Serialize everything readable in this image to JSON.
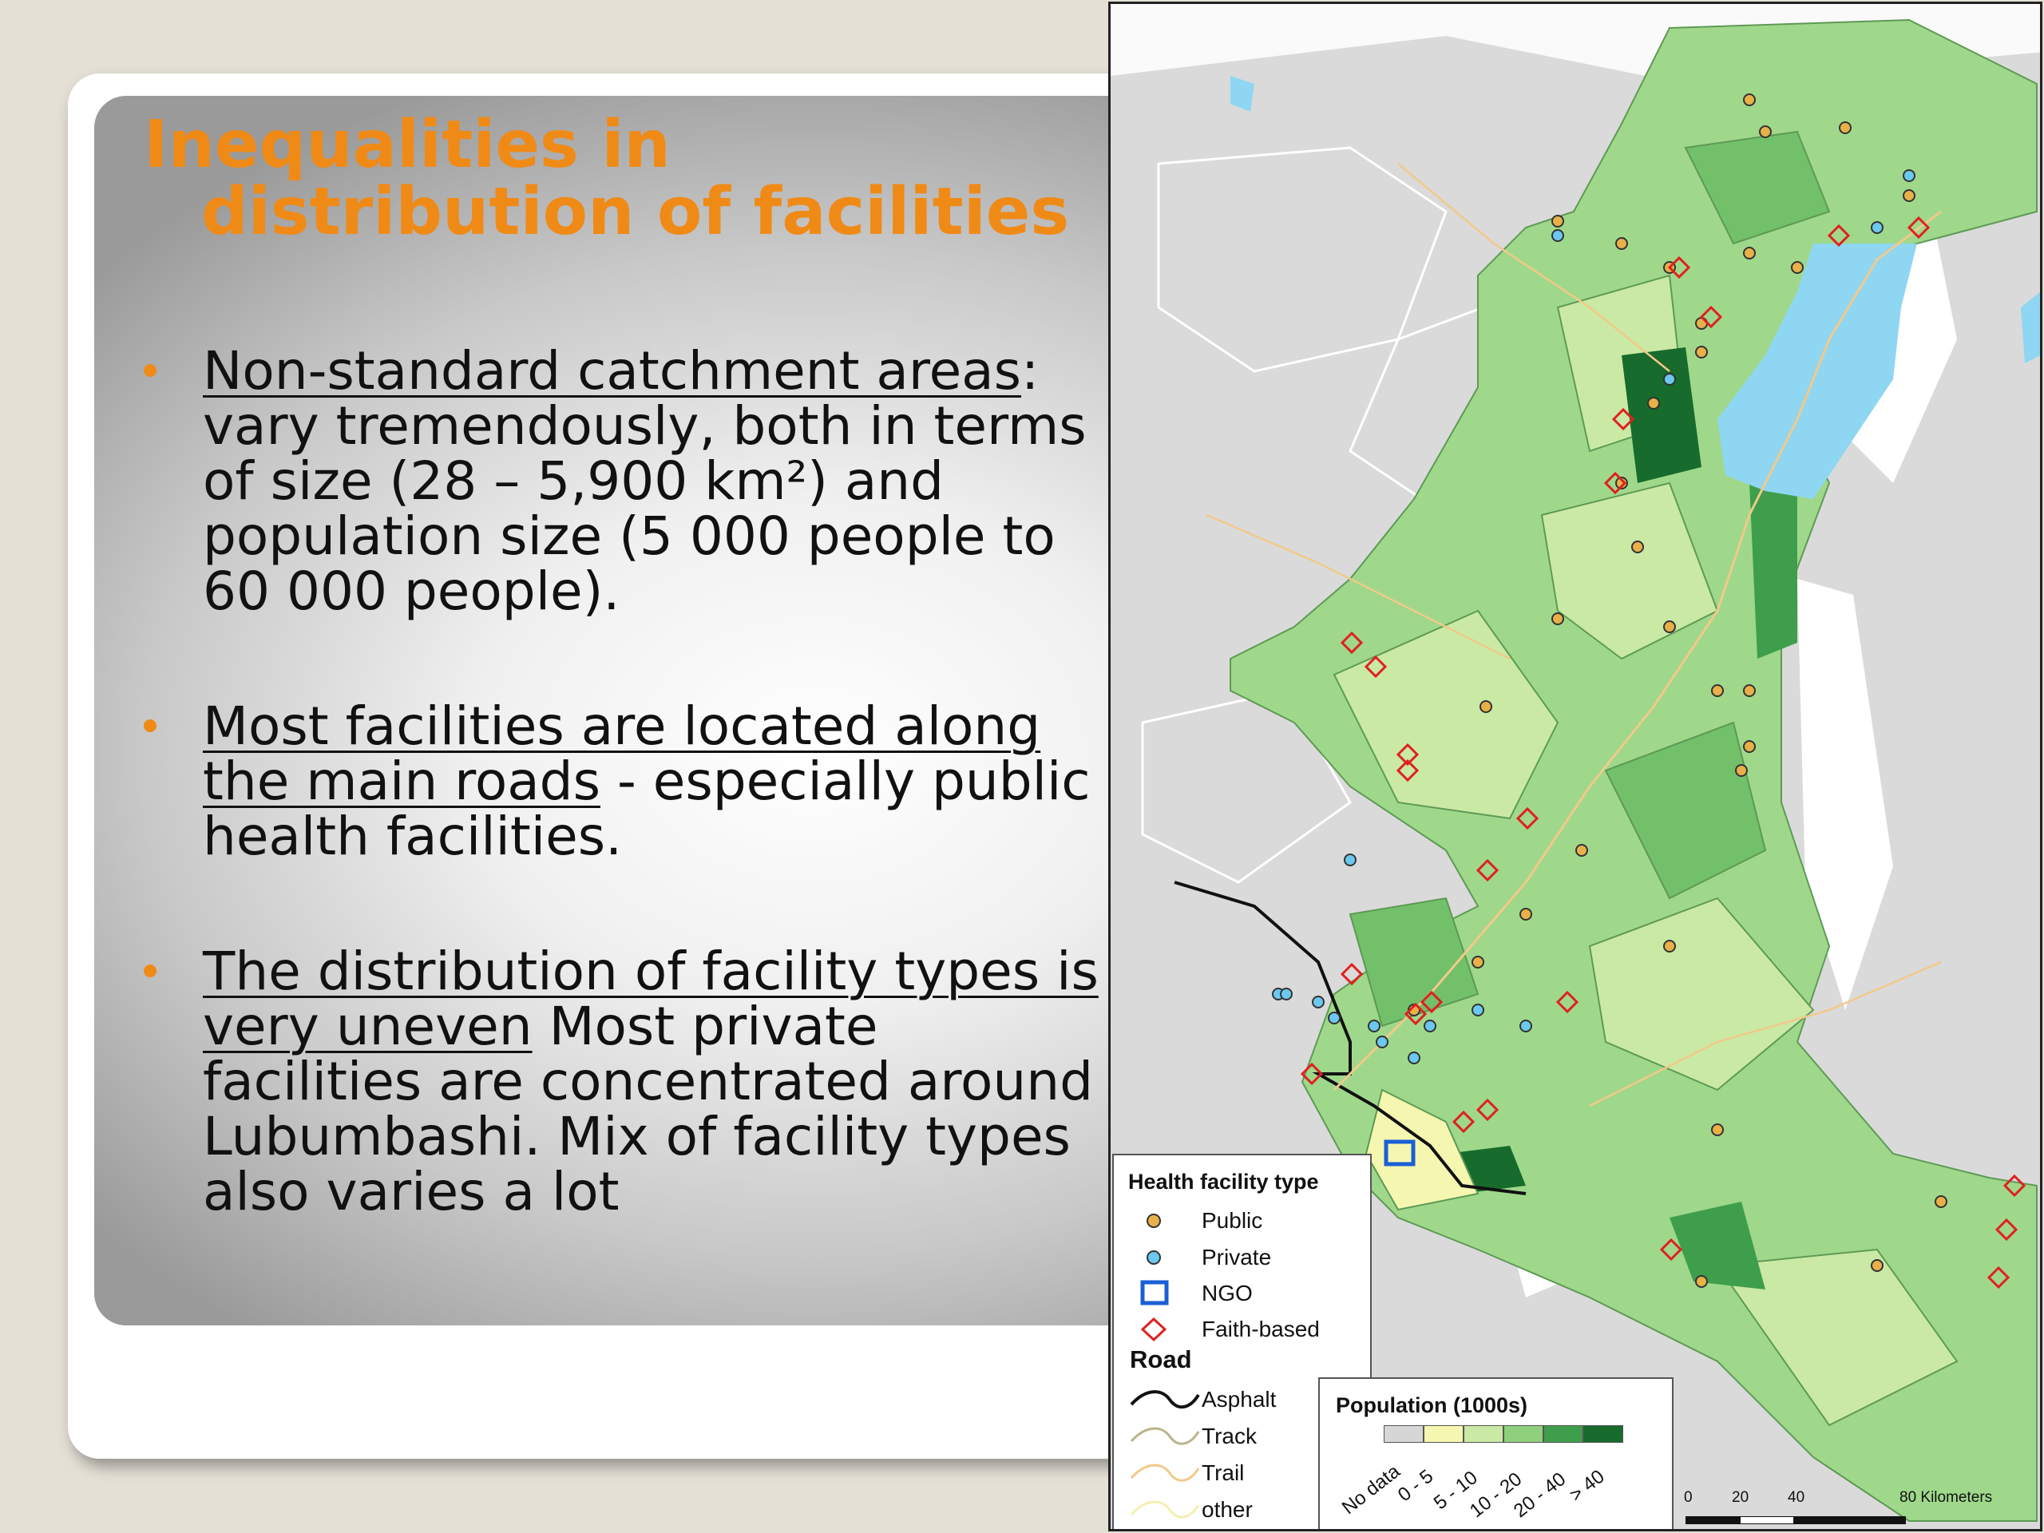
{
  "slide": {
    "title_line1": "Inequalities in",
    "title_line2": "distribution of facilities",
    "bullets": [
      {
        "underlined": "Non-standard catchment areas",
        "rest": ": vary tremendously, both in terms of size (28 – 5,900 km²) and population size (5 000 people to 60 000 people)."
      },
      {
        "underlined": "Most facilities are located along the main roads",
        "rest": " - especially public health facilities."
      },
      {
        "underlined": "The distribution of facility types is very uneven",
        "rest": " Most private facilities are concentrated around Lubumbashi. Mix of facility types also varies a lot"
      }
    ],
    "accent_color": "#f08a17"
  },
  "map": {
    "legend": {
      "facility_title": "Health facility type",
      "facility_types": [
        {
          "label": "Public",
          "symbol": "circle",
          "color": "#e8b04a"
        },
        {
          "label": "Private",
          "symbol": "circle",
          "color": "#6cc8ee"
        },
        {
          "label": "NGO",
          "symbol": "square",
          "color": "#1b5fd6"
        },
        {
          "label": "Faith-based",
          "symbol": "diamond",
          "color": "#e02020"
        }
      ],
      "road_title": "Road",
      "road_types": [
        {
          "label": "Asphalt",
          "color": "#111111"
        },
        {
          "label": "Track",
          "color": "#b9b48a"
        },
        {
          "label": "Trail",
          "color": "#f2c98a"
        },
        {
          "label": "other",
          "color": "#f5efb0"
        }
      ]
    },
    "population_legend": {
      "title": "Population (1000s)",
      "classes": [
        {
          "label": "No data",
          "color": "#d6d6d6"
        },
        {
          "label": "0 - 5",
          "color": "#f5f7b0"
        },
        {
          "label": "5 - 10",
          "color": "#c9e9a5"
        },
        {
          "label": "10 - 20",
          "color": "#8fd07c"
        },
        {
          "label": "20 - 40",
          "color": "#3f9e4c"
        },
        {
          "label": "> 40",
          "color": "#176b2c"
        }
      ]
    },
    "scale_bar": {
      "ticks": [
        "0",
        "20",
        "40",
        "80 Kilometers"
      ]
    },
    "colors": {
      "lake": "#8fd6f2",
      "outside": "#d7d7d7",
      "unpopulated": "#ffffff"
    }
  }
}
